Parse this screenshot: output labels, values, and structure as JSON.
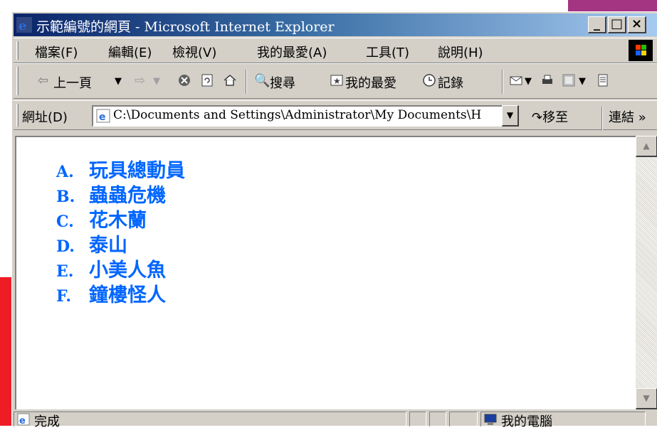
{
  "window": {
    "title": "示範編號的網頁 - Microsoft Internet Explorer",
    "buttons": {
      "minimize": "_",
      "maximize": "□",
      "close": "×"
    }
  },
  "menu": {
    "items": [
      "檔案(F)",
      "編輯(E)",
      "檢視(V)",
      "我的最愛(A)",
      "工具(T)",
      "說明(H)"
    ]
  },
  "toolbar": {
    "back": "上一頁",
    "search": "搜尋",
    "favorites": "我的最愛",
    "history": "記錄"
  },
  "address": {
    "label": "網址(D)",
    "value": "C:\\Documents and Settings\\Administrator\\My Documents\\H",
    "go": "移至",
    "links": "連結 »"
  },
  "content": {
    "color": "#0066ff",
    "items": [
      {
        "marker": "A.",
        "text": "玩具總動員"
      },
      {
        "marker": "B.",
        "text": "蟲蟲危機"
      },
      {
        "marker": "C.",
        "text": "花木蘭"
      },
      {
        "marker": "D.",
        "text": "泰山"
      },
      {
        "marker": "E.",
        "text": "小美人魚"
      },
      {
        "marker": "F.",
        "text": "鐘樓怪人"
      }
    ]
  },
  "status": {
    "text": "完成",
    "zone": "我的電腦"
  }
}
